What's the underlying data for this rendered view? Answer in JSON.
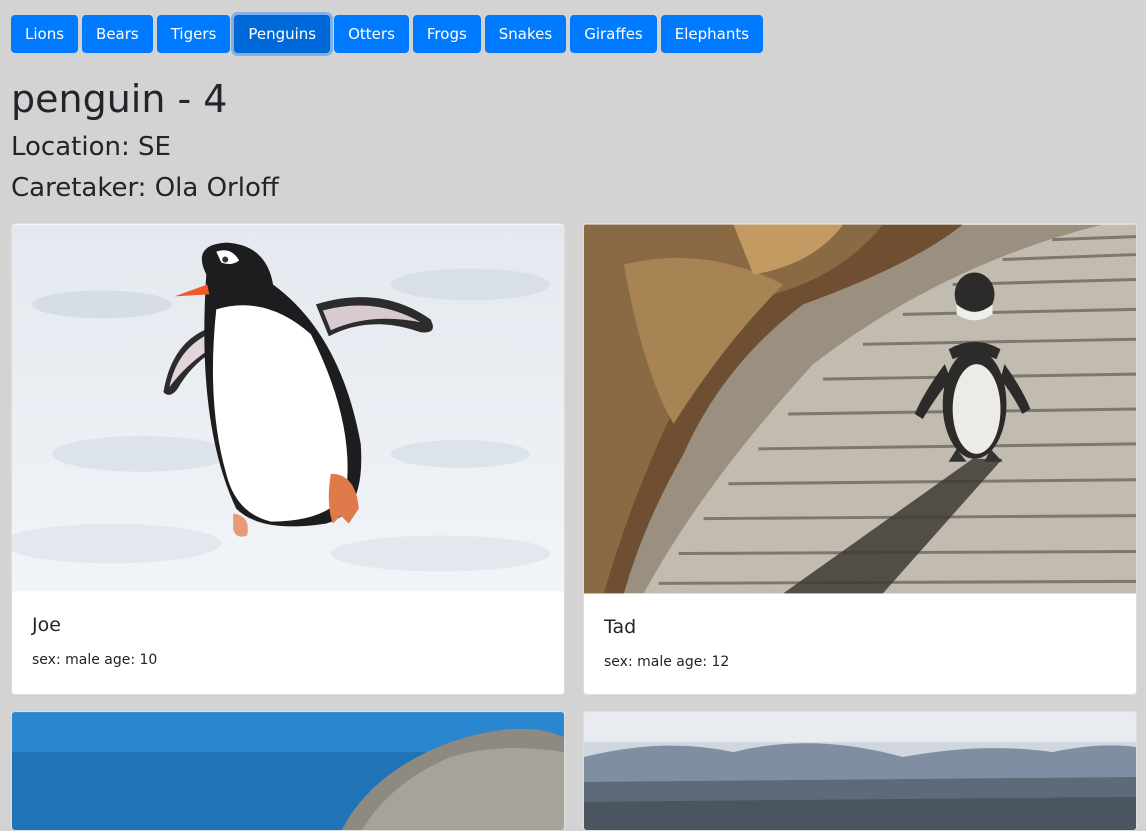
{
  "nav": {
    "buttons": [
      {
        "label": "Lions"
      },
      {
        "label": "Bears"
      },
      {
        "label": "Tigers"
      },
      {
        "label": "Penguins"
      },
      {
        "label": "Otters"
      },
      {
        "label": "Frogs"
      },
      {
        "label": "Snakes"
      },
      {
        "label": "Giraffes"
      },
      {
        "label": "Elephants"
      }
    ],
    "active": "Penguins"
  },
  "heading": {
    "title": "penguin - 4",
    "location": "Location: SE",
    "caretaker": "Caretaker: Ola Orloff"
  },
  "cards": [
    {
      "name": "Joe",
      "details": "sex: male age: 10"
    },
    {
      "name": "Tad",
      "details": "sex: male age: 12"
    }
  ],
  "colors": {
    "button": "#007bff",
    "background": "#d3d3d3"
  }
}
